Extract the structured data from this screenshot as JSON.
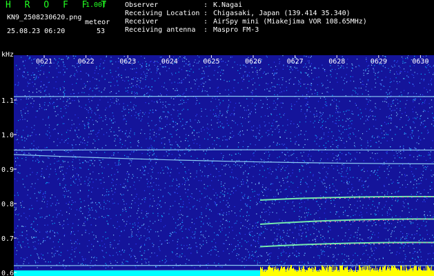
{
  "app": {
    "title": "H R O F F T",
    "version": "1.00f"
  },
  "file": {
    "name": "KN9_2508230620.png",
    "datetime": "25.08.23 06:20"
  },
  "meteor": {
    "label": "meteor",
    "count": "53"
  },
  "info": [
    {
      "key": "Observer",
      "value": "K.Nagai"
    },
    {
      "key": "Receiving Location",
      "value": "Chigasaki, Japan (139.414 35.340)"
    },
    {
      "key": "Receiver",
      "value": "AirSpy mini (Miakejima VOR 108.65MHz)"
    },
    {
      "key": "Receiving antenna",
      "value": "Maspro FM-3"
    }
  ],
  "colors": {
    "title": "#22ff22",
    "background": "#000000",
    "plot_bg": "#14149a",
    "baseline": "#00ffff",
    "burst": "#ffff00"
  },
  "chart_data": {
    "type": "heatmap",
    "ylabel": "kHz",
    "x_ticks": [
      "0621",
      "0622",
      "0623",
      "0624",
      "0625",
      "0626",
      "0627",
      "0628",
      "0629",
      "0630"
    ],
    "y_ticks": [
      "1.1",
      "1.0",
      "0.9",
      "0.8",
      "0.7",
      "0.6"
    ],
    "ylim": [
      0.59,
      1.23
    ],
    "carriers": [
      {
        "name": "carrier-1.11",
        "start": "0621",
        "end": "0630",
        "y_start": 1.11,
        "y_end": 1.11
      },
      {
        "name": "carrier-0.955",
        "start": "0621",
        "end": "0630",
        "y_start": 0.955,
        "y_end": 0.955
      },
      {
        "name": "carrier-0.94",
        "start": "0621",
        "end": "0630",
        "y_start": 0.942,
        "y_end": 0.915
      },
      {
        "name": "carrier-0.81",
        "start": "0626",
        "end": "0630",
        "y_start": 0.81,
        "y_end": 0.82
      },
      {
        "name": "carrier-0.74",
        "start": "0626",
        "end": "0630",
        "y_start": 0.74,
        "y_end": 0.755
      },
      {
        "name": "carrier-0.67",
        "start": "0626",
        "end": "0630",
        "y_start": 0.675,
        "y_end": 0.687
      },
      {
        "name": "carrier-0.62",
        "start": "0621",
        "end": "0630",
        "y_start": 0.62,
        "y_end": 0.62
      },
      {
        "name": "carrier-0.605",
        "start": "0621",
        "end": "0630",
        "y_start": 0.605,
        "y_end": 0.605
      }
    ],
    "grid": false
  }
}
